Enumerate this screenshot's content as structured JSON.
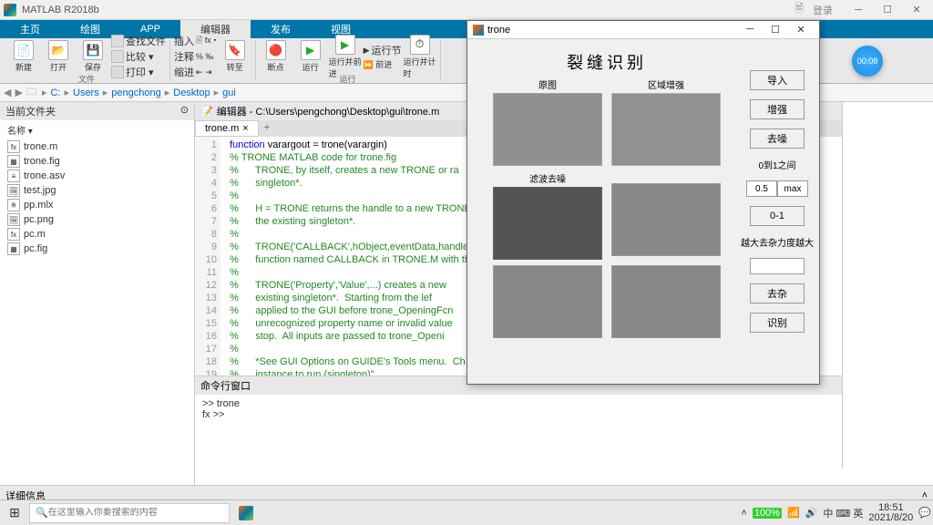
{
  "titlebar": {
    "app": "MATLAB R2018b",
    "login": "登录",
    "search_ico": "🗎"
  },
  "tabs": [
    "主页",
    "绘图",
    "APP",
    "编辑器",
    "发布",
    "视图"
  ],
  "tabs_active": 3,
  "ribbon": {
    "group1": {
      "btn1": "新建",
      "btn2": "打开",
      "btn3": "保存",
      "label": "文件",
      "small": [
        "查找文件",
        "比较 ▾",
        "打印 ▾"
      ]
    },
    "group2": {
      "btn1": "断点",
      "small": [
        "插入",
        "注释",
        "缩进"
      ]
    },
    "group3": {
      "label": "运行",
      "btn1": "断点",
      "btn2": "运行",
      "btn3": "运行并前进",
      "btn4": "运行节",
      "btn5": "运行并计时",
      "opt": "运行节"
    }
  },
  "timer": "00:08",
  "breadcrumb": [
    "C:",
    "Users",
    "pengchong",
    "Desktop",
    "gui"
  ],
  "sidebar": {
    "header": "当前文件夹",
    "col": "名称 ▾",
    "files": [
      "trone.m",
      "trone.fig",
      "trone.asv",
      "test.jpg",
      "pp.mlx",
      "pc.png",
      "pc.m",
      "pc.fig"
    ]
  },
  "editor": {
    "header_prefix": "编辑器 - ",
    "path": "C:\\Users\\pengchong\\Desktop\\gui\\trone.m",
    "tab": "trone.m",
    "lines": [
      {
        "n": 1,
        "kw": "function",
        "t": " varargout = trone(varargin)"
      },
      {
        "n": 2,
        "c": "% TRONE MATLAB code for trone.fig"
      },
      {
        "n": 3,
        "c": "%      TRONE, by itself, creates a new TRONE or ra"
      },
      {
        "n": 4,
        "c": "%      singleton*."
      },
      {
        "n": 5,
        "c": "%"
      },
      {
        "n": 6,
        "c": "%      H = TRONE returns the handle to a new TRONE"
      },
      {
        "n": 7,
        "c": "%      the existing singleton*."
      },
      {
        "n": 8,
        "c": "%"
      },
      {
        "n": 9,
        "c": "%      TRONE('CALLBACK',hObject,eventData,handles,"
      },
      {
        "n": 10,
        "c": "%      function named CALLBACK in TRONE.M with the"
      },
      {
        "n": 11,
        "c": "%"
      },
      {
        "n": 12,
        "c": "%      TRONE('Property','Value',...) creates a new"
      },
      {
        "n": 13,
        "c": "%      existing singleton*.  Starting from the lef"
      },
      {
        "n": 14,
        "c": "%      applied to the GUI before trone_OpeningFcn"
      },
      {
        "n": 15,
        "c": "%      unrecognized property name or invalid value"
      },
      {
        "n": 16,
        "c": "%      stop.  All inputs are passed to trone_Openi"
      },
      {
        "n": 17,
        "c": "%"
      },
      {
        "n": 18,
        "c": "%      *See GUI Options on GUIDE's Tools menu.  Ch"
      },
      {
        "n": 19,
        "c": "%      instance to run (singleton)\"."
      }
    ]
  },
  "cmd": {
    "header": "命令行窗口",
    "line1": ">> trone",
    "prompt": "fx >>"
  },
  "bottom": {
    "header": "详细信息",
    "status": "|||-"
  },
  "gui": {
    "title": "trone",
    "bigtitle": "裂缝识别",
    "caps": [
      "原图",
      "区域增强",
      "滤波去噪"
    ],
    "buttons": [
      "导入",
      "增强",
      "去噪",
      "0-1",
      "去杂",
      "识别"
    ],
    "label1": "0到1之间",
    "label2": "越大去杂力度越大",
    "val1": "0.5",
    "val2": "max"
  },
  "taskbar": {
    "search_placeholder": "在这里输入你要搜索的内容",
    "battery": "100%",
    "ime": "中 ⌨ 英",
    "time": "18:51",
    "date": "2021/8/20"
  }
}
